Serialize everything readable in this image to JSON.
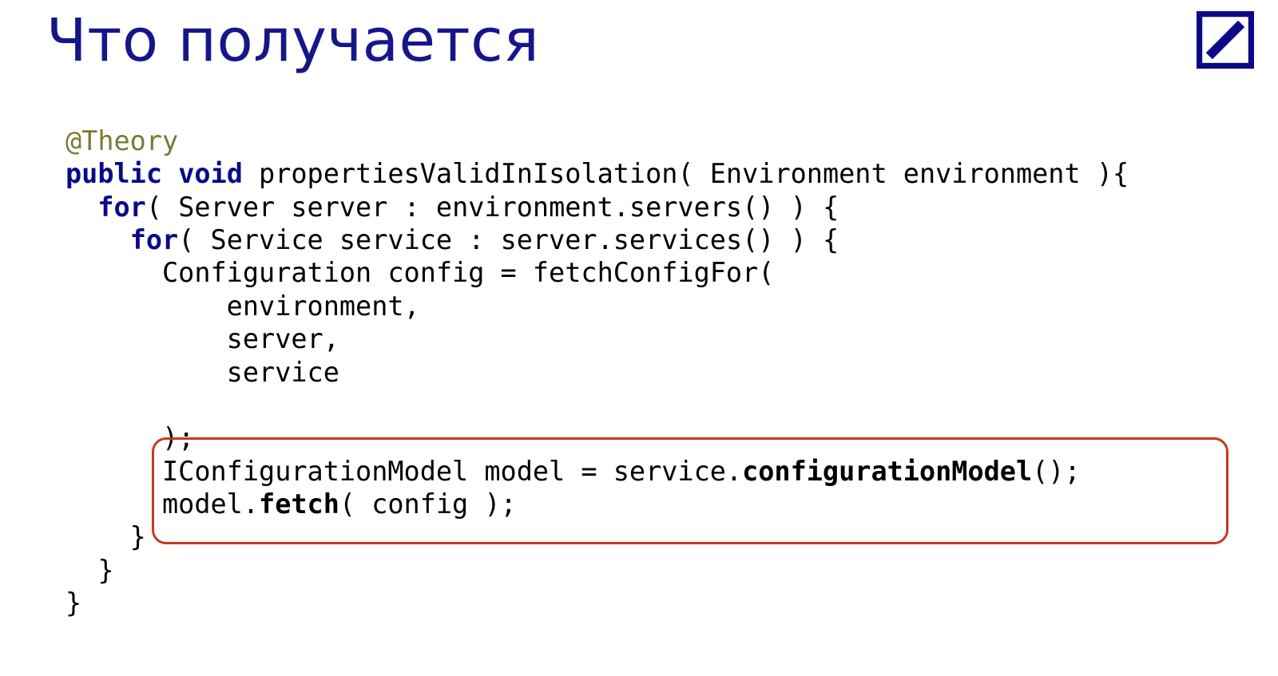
{
  "slide": {
    "title": "Что получается"
  },
  "code": {
    "l1_annotation": "@Theory",
    "l2_kw1": "public",
    "l2_kw2": "void",
    "l2_rest": " propertiesValidInIsolation( Environment environment ){",
    "l3_indent": "  ",
    "l3_kw": "for",
    "l3_rest": "( Server server : environment.servers() ) {",
    "l4_indent": "    ",
    "l4_kw": "for",
    "l4_rest": "( Service service : server.services() ) {",
    "l5": "      Configuration config = fetchConfigFor(",
    "l6": "          environment,",
    "l7": "          server,",
    "l8": "          service",
    "l9": "",
    "l10": "      );",
    "l11_a": "      IConfigurationModel model = service.",
    "l11_b": "configurationModel",
    "l11_c": "();",
    "l12_a": "      model.",
    "l12_b": "fetch",
    "l12_c": "( config );",
    "l13": "    }",
    "l14": "  }",
    "l15": "}"
  }
}
